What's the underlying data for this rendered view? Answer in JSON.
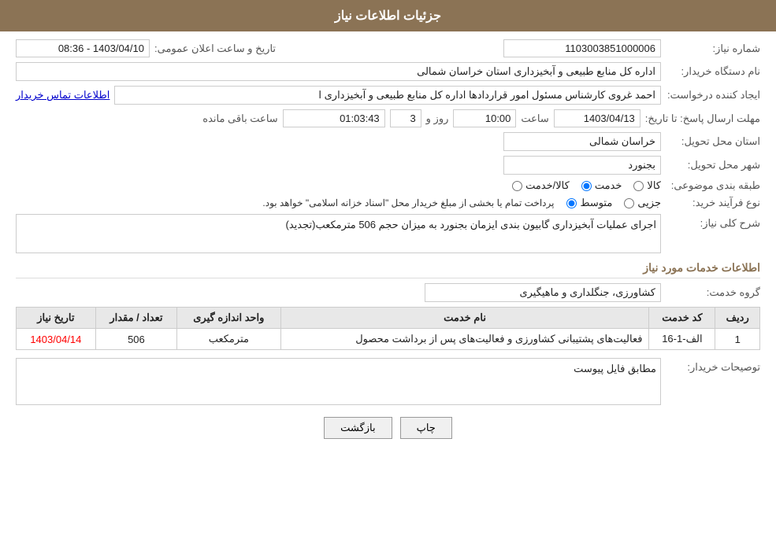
{
  "header": {
    "title": "جزئیات اطلاعات نیاز"
  },
  "fields": {
    "need_number_label": "شماره نیاز:",
    "need_number_value": "1103003851000006",
    "buyer_org_label": "نام دستگاه خریدار:",
    "buyer_org_value": "اداره کل منابع طبیعی و آبخیزداری استان خراسان شمالی",
    "creator_label": "ایجاد کننده درخواست:",
    "creator_value": "احمد غروی کارشناس مسئول امور قراردادها اداره کل منابع طبیعی و آبخیزداری ا",
    "creator_link": "اطلاعات تماس خریدار",
    "response_deadline_label": "مهلت ارسال پاسخ: تا تاریخ:",
    "response_date": "1403/04/13",
    "response_time_label": "ساعت",
    "response_time": "10:00",
    "response_day_label": "روز و",
    "response_days": "3",
    "remaining_label": "ساعت باقی مانده",
    "remaining_time": "01:03:43",
    "datetime_label": "تاریخ و ساعت اعلان عمومی:",
    "datetime_value": "1403/04/10 - 08:36",
    "delivery_province_label": "استان محل تحویل:",
    "delivery_province_value": "خراسان شمالی",
    "delivery_city_label": "شهر محل تحویل:",
    "delivery_city_value": "بجنورد",
    "category_label": "طبقه بندی موضوعی:",
    "category_options": [
      {
        "id": "kala",
        "label": "کالا",
        "checked": false
      },
      {
        "id": "khadamat",
        "label": "خدمت",
        "checked": true
      },
      {
        "id": "kala_khadamat",
        "label": "کالا/خدمت",
        "checked": false
      }
    ],
    "purchase_type_label": "نوع فرآیند خرید:",
    "purchase_type_options": [
      {
        "id": "jozei",
        "label": "جزیی",
        "checked": false
      },
      {
        "id": "motavasset",
        "label": "متوسط",
        "checked": true
      }
    ],
    "purchase_note": "پرداخت تمام یا بخشی از مبلغ خریدار محل \"اسناد خزانه اسلامی\" خواهد بود.",
    "description_label": "شرح کلی نیاز:",
    "description_value": "اجرای عملیات آبخیزداری گابیون بندی ایزمان بجنورد به میزان حجم 506 مترمکعب(تجدید)",
    "services_section_label": "اطلاعات خدمات مورد نیاز",
    "service_group_label": "گروه خدمت:",
    "service_group_value": "کشاورزی، جنگلداری و ماهیگیری",
    "table": {
      "headers": [
        "ردیف",
        "کد خدمت",
        "نام خدمت",
        "واحد اندازه گیری",
        "تعداد / مقدار",
        "تاریخ نیاز"
      ],
      "rows": [
        {
          "row": "1",
          "code": "الف-1-16",
          "name": "فعالیت‌های پشتیبانی کشاورزی و فعالیت‌های پس از برداشت محصول",
          "unit": "مترمکعب",
          "quantity": "506",
          "date": "1403/04/14"
        }
      ]
    },
    "buyer_notes_label": "توصیحات خریدار:",
    "buyer_notes_value": "مطابق فایل پیوست"
  },
  "buttons": {
    "print": "چاپ",
    "back": "بازگشت"
  }
}
